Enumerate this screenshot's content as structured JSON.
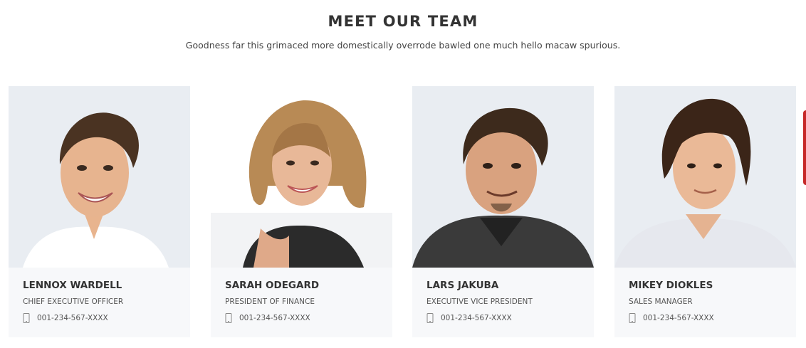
{
  "section": {
    "title": "MEET OUR TEAM",
    "subtitle": "Goodness far this grimaced more domestically overrode bawled one much hello macaw spurious."
  },
  "team": [
    {
      "name": "LENNOX WARDELL",
      "role": "CHIEF EXECUTIVE OFFICER",
      "phone": "001-234-567-XXXX",
      "photo": "portrait-smiling-man-brown-hair-white-shirt"
    },
    {
      "name": "SARAH ODEGARD",
      "role": "PRESIDENT OF FINANCE",
      "phone": "001-234-567-XXXX",
      "photo": "portrait-smiling-woman-curly-hair-black-top"
    },
    {
      "name": "LARS JAKUBA",
      "role": "EXECUTIVE VICE PRESIDENT",
      "phone": "001-234-567-XXXX",
      "photo": "portrait-smiling-man-goatee-dark-jacket"
    },
    {
      "name": "MIKEY DIOKLES",
      "role": "SALES MANAGER",
      "phone": "001-234-567-XXXX",
      "photo": "portrait-young-man-long-hair-light-shirt"
    }
  ],
  "icons": {
    "phone": "mobile-phone-icon"
  },
  "colors": {
    "heading": "#333333",
    "card_background": "#f7f8fa",
    "photo_background": "#e9edf2",
    "accent": "#c62828"
  }
}
